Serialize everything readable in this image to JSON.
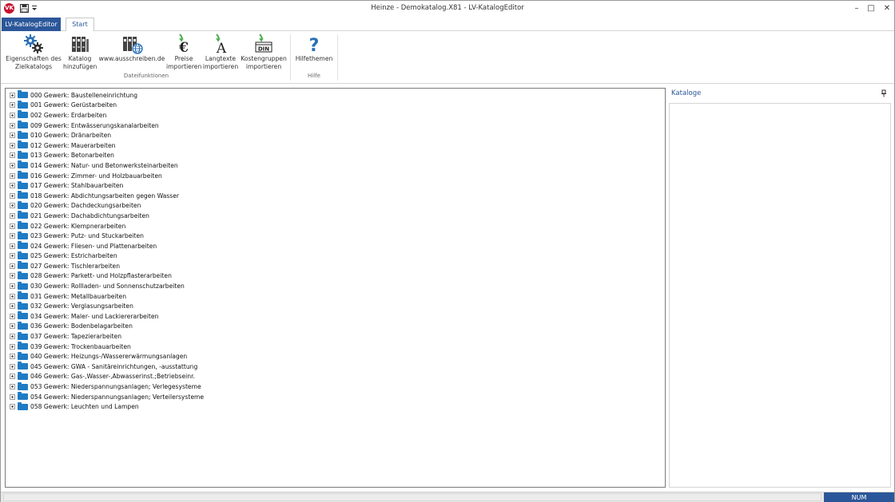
{
  "window": {
    "title": "Heinze - Demokatalog.X81 - LV-KatalogEditor",
    "logo_text": "VK",
    "minimize": "–",
    "maximize": "□",
    "close": "✕"
  },
  "ribbon": {
    "tabs": [
      {
        "label": "LV-KatalogEditor"
      },
      {
        "label": "Start"
      }
    ],
    "groups": [
      {
        "label": "Dateifunktionen",
        "buttons": [
          {
            "line1": "Eigenschaften des",
            "line2": "Zielkatalogs",
            "icon": "gears-icon"
          },
          {
            "line1": "Katalog",
            "line2": "hinzufügen",
            "icon": "catalog-binders-icon"
          },
          {
            "line1": "www.ausschreiben.de",
            "line2": "",
            "icon": "web-binders-icon"
          },
          {
            "line1": "Preise",
            "line2": "importieren",
            "icon": "euro-import-icon"
          },
          {
            "line1": "Langtexte",
            "line2": "importieren",
            "icon": "text-import-icon"
          },
          {
            "line1": "Kostengruppen",
            "line2": "importieren",
            "icon": "din-import-icon"
          }
        ]
      },
      {
        "label": "Hilfe",
        "buttons": [
          {
            "line1": "Hilfethemen",
            "line2": "",
            "icon": "help-icon"
          }
        ]
      }
    ]
  },
  "tree": {
    "items": [
      "000 Gewerk: Baustelleneinrichtung",
      "001 Gewerk: Gerüstarbeiten",
      "002 Gewerk: Erdarbeiten",
      "009 Gewerk: Entwässerungskanalarbeiten",
      "010 Gewerk: Dränarbeiten",
      "012 Gewerk: Mauerarbeiten",
      "013 Gewerk: Betonarbeiten",
      "014 Gewerk: Natur- und Betonwerksteinarbeiten",
      "016 Gewerk: Zimmer- und Holzbauarbeiten",
      "017 Gewerk: Stahlbauarbeiten",
      "018 Gewerk: Abdichtungsarbeiten gegen Wasser",
      "020 Gewerk: Dachdeckungsarbeiten",
      "021 Gewerk: Dachabdichtungsarbeiten",
      "022 Gewerk: Klempnerarbeiten",
      "023 Gewerk: Putz- und Stuckarbeiten",
      "024 Gewerk: Fliesen- und Plattenarbeiten",
      "025 Gewerk: Estricharbeiten",
      "027 Gewerk: Tischlerarbeiten",
      "028 Gewerk: Parkett- und Holzpflasterarbeiten",
      "030 Gewerk: Rollladen- und Sonnenschutzarbeiten",
      "031 Gewerk: Metallbauarbeiten",
      "032 Gewerk: Verglasungsarbeiten",
      "034 Gewerk: Maler- und Lackiererarbeiten",
      "036 Gewerk: Bodenbelagarbeiten",
      "037 Gewerk: Tapezierarbeiten",
      "039 Gewerk: Trockenbauarbeiten",
      "040 Gewerk: Heizungs-/Wassererwärmungsanlagen",
      "045 Gewerk: GWA - Sanitäreinrichtungen, -ausstattung",
      "046 Gewerk: Gas-,Wasser-,Abwasserinst.;Betriebseinr.",
      "053 Gewerk: Niederspannungsanlagen; Verlegesysteme",
      "054 Gewerk: Niederspannungsanlagen; Verteilersysteme",
      "058 Gewerk: Leuchten und Lampen"
    ]
  },
  "side_panel": {
    "title": "Kataloge"
  },
  "statusbar": {
    "num": "NUM"
  },
  "colors": {
    "accent": "#2b579a",
    "folder": "#1f7bc4"
  }
}
